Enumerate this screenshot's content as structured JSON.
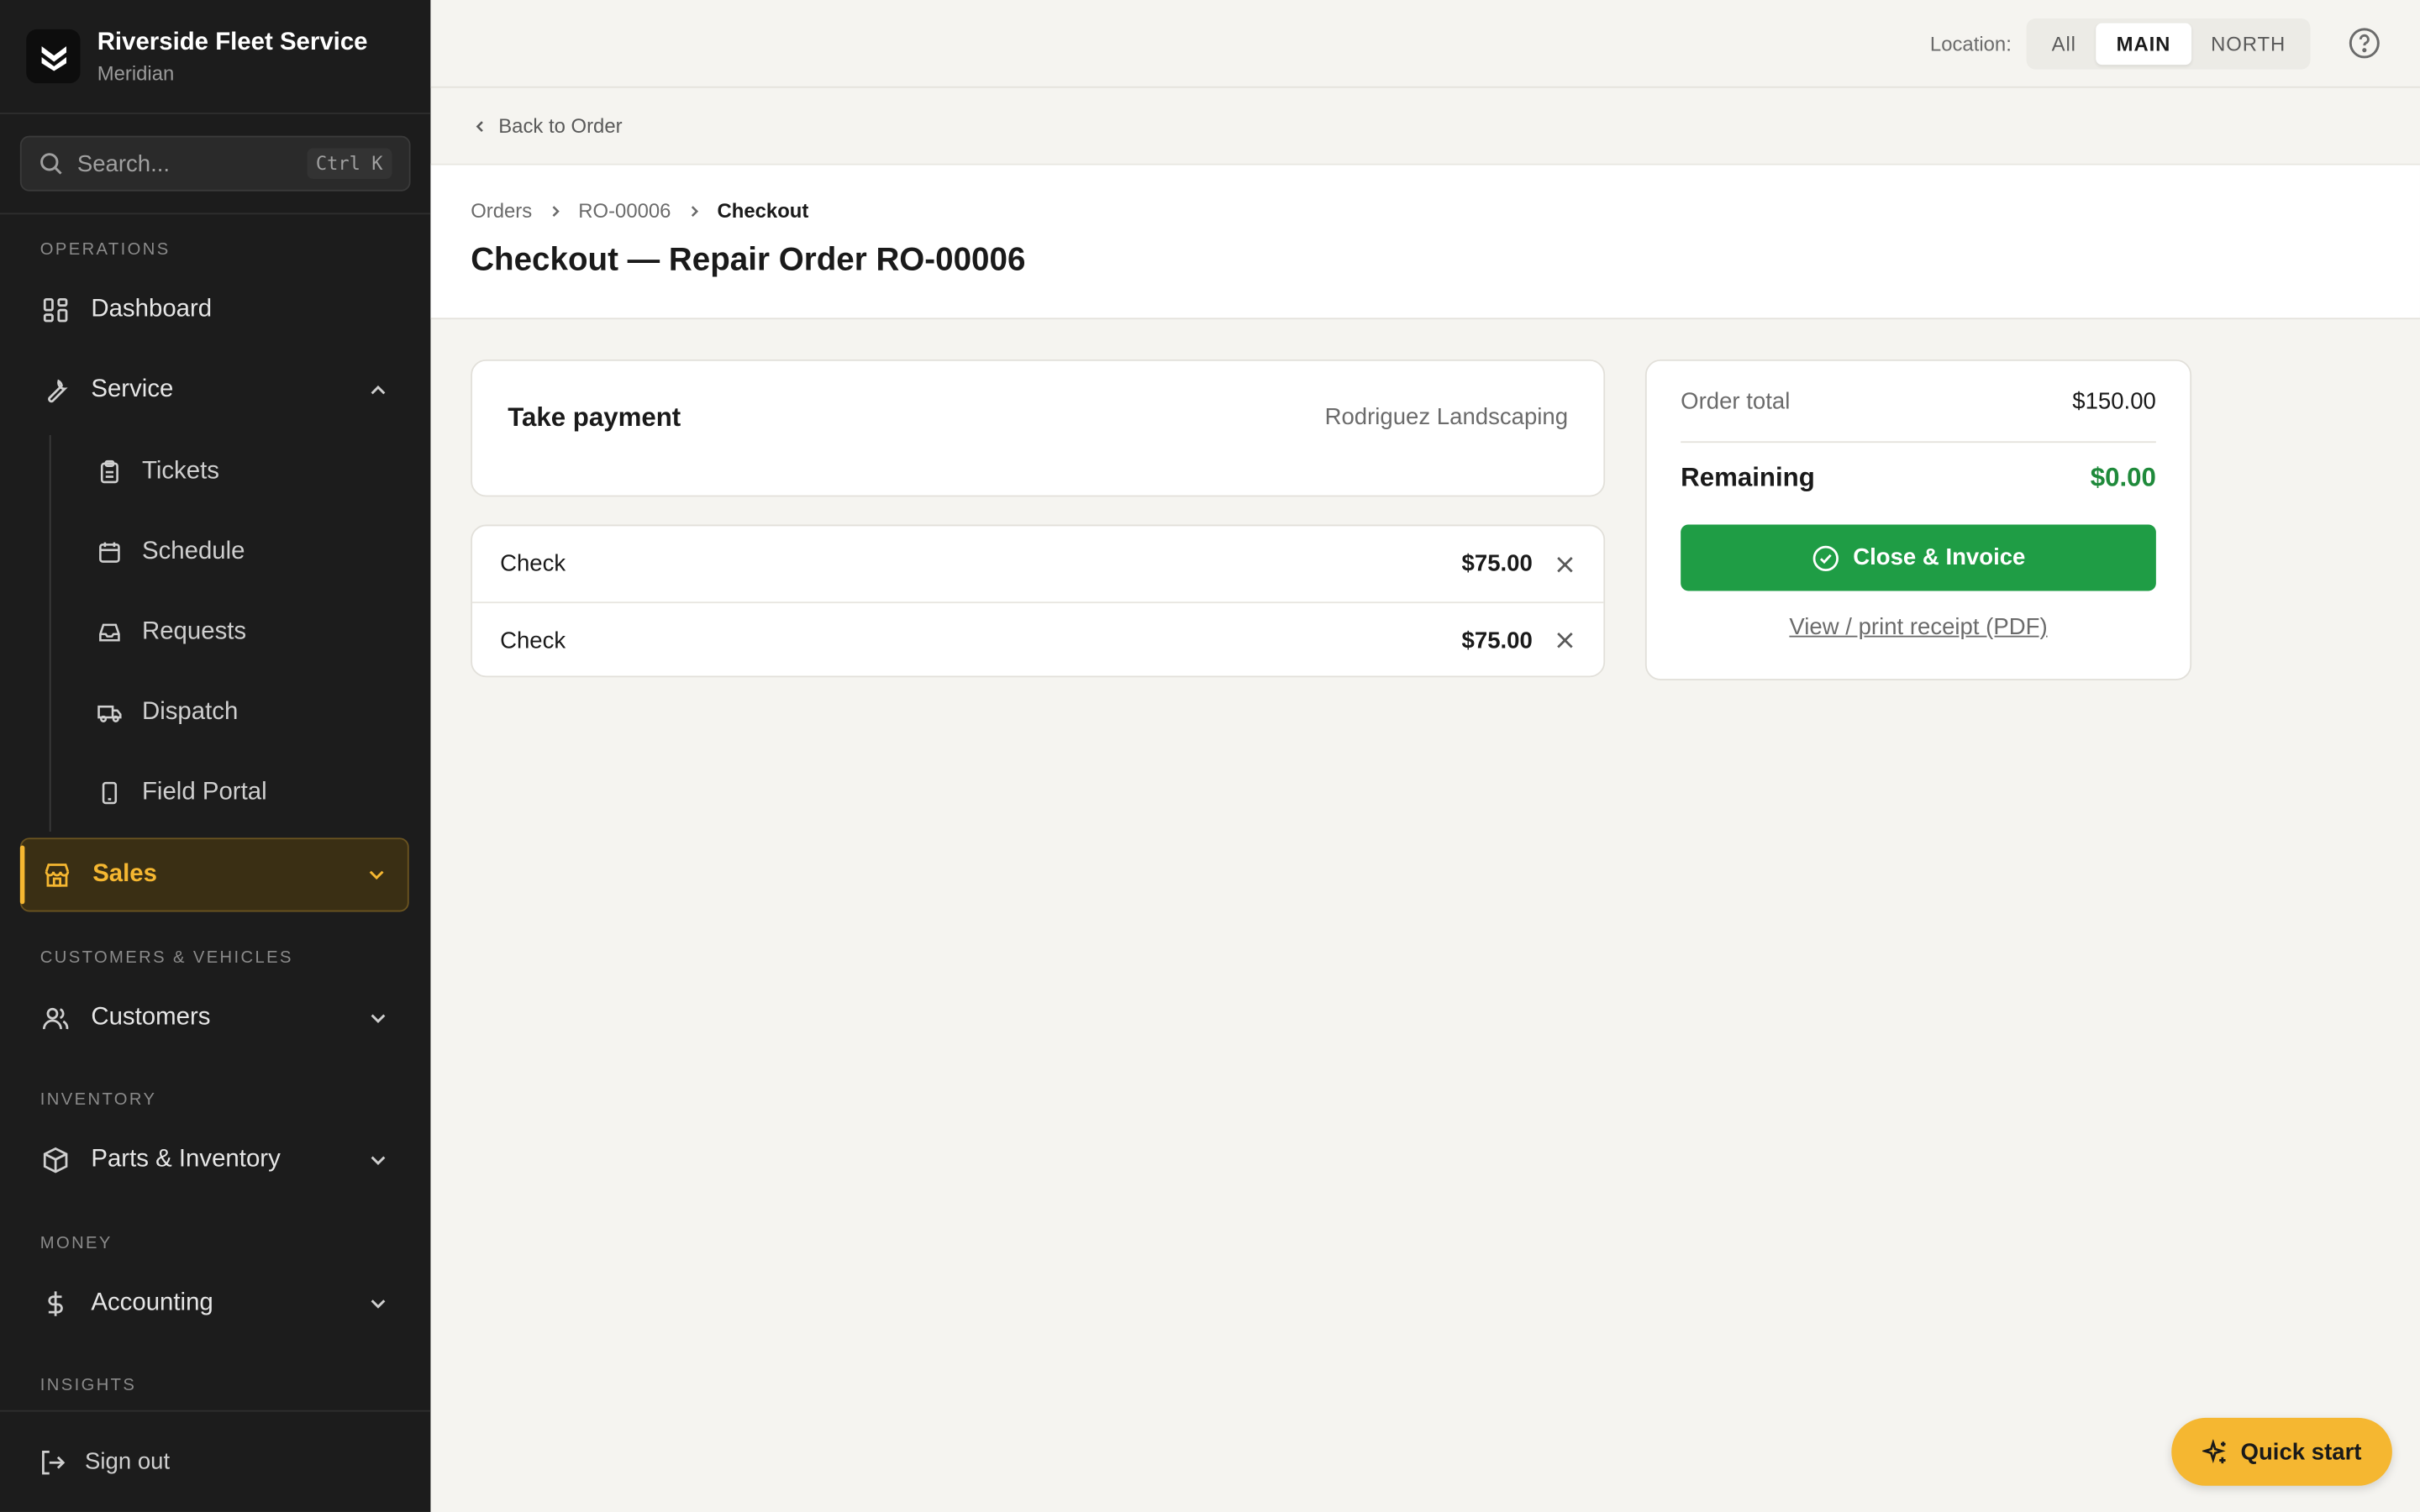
{
  "brand": {
    "name": "Riverside Fleet Service",
    "sub": "Meridian",
    "logo_icon": "brand-logo-icon"
  },
  "search": {
    "placeholder": "Search...",
    "shortcut": "Ctrl K"
  },
  "sidebar": {
    "sections": {
      "operations": "OPERATIONS",
      "customers_vehicles": "CUSTOMERS & VEHICLES",
      "inventory": "INVENTORY",
      "money": "MONEY",
      "insights": "INSIGHTS"
    },
    "items": {
      "dashboard": "Dashboard",
      "service": "Service",
      "tickets": "Tickets",
      "schedule": "Schedule",
      "requests": "Requests",
      "dispatch": "Dispatch",
      "field_portal": "Field Portal",
      "sales": "Sales",
      "customers": "Customers",
      "parts_inventory": "Parts & Inventory",
      "accounting": "Accounting"
    },
    "signout": "Sign out"
  },
  "topbar": {
    "location_label": "Location:",
    "locations": [
      "All",
      "MAIN",
      "NORTH"
    ],
    "selected_location": "MAIN"
  },
  "back_link": "Back to Order",
  "breadcrumb": [
    "Orders",
    "RO-00006",
    "Checkout"
  ],
  "page_title": "Checkout — Repair Order RO-00006",
  "payment": {
    "title": "Take payment",
    "customer": "Rodriguez Landscaping",
    "lines": [
      {
        "method": "Check",
        "amount": "$75.00"
      },
      {
        "method": "Check",
        "amount": "$75.00"
      }
    ]
  },
  "summary": {
    "total_label": "Order total",
    "total_value": "$150.00",
    "remaining_label": "Remaining",
    "remaining_value": "$0.00",
    "invoice_button": "Close & Invoice",
    "receipt_link": "View / print receipt (PDF)"
  },
  "quick_start": "Quick start",
  "colors": {
    "accent": "#f5b731",
    "success": "#1f9d45",
    "sidebar_bg": "#1c1c1c"
  }
}
